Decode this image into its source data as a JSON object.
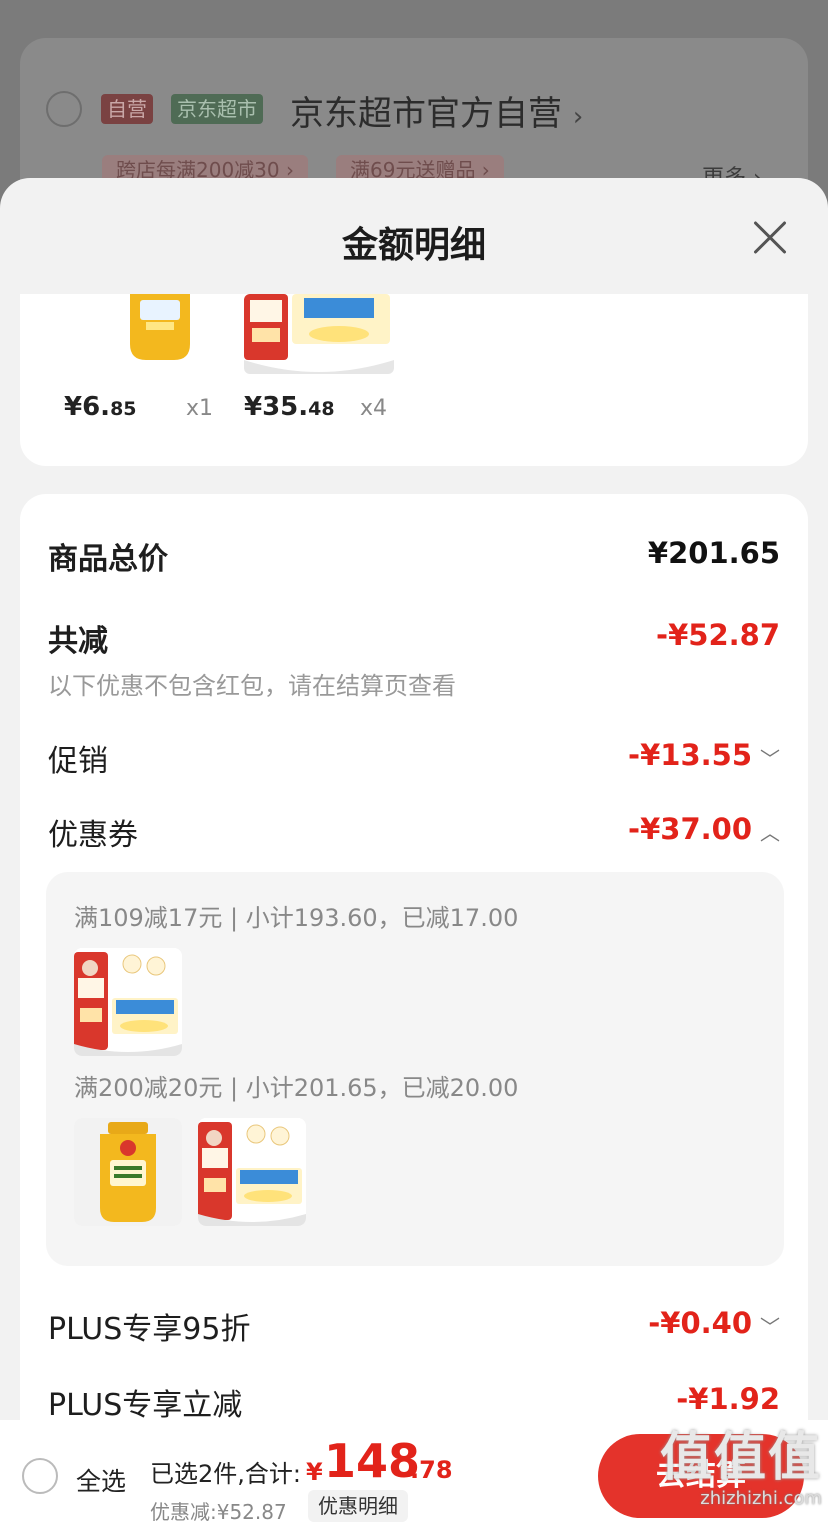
{
  "background": {
    "shop_tag_self": "自营",
    "shop_tag_jd": "京东超市",
    "shop_name": "京东超市官方自营",
    "promo_1": "跨店每满200减30",
    "promo_2": "满69元送赠品",
    "more": "更多"
  },
  "sheet": {
    "title": "金额明细"
  },
  "items": [
    {
      "price_int": "¥6.",
      "price_dec": "85",
      "qty": "x1"
    },
    {
      "price_int": "¥35.",
      "price_dec": "48",
      "qty": "x4"
    }
  ],
  "summary": {
    "total_label": "商品总价",
    "total_value": "¥201.65",
    "reduce_label": "共减",
    "reduce_value": "-¥52.87",
    "reduce_note": "以下优惠不包含红包，请在结算页查看",
    "promo_label": "促销",
    "promo_value": "-¥13.55",
    "coupon_label": "优惠券",
    "coupon_value": "-¥37.00",
    "coupons": [
      {
        "text": "满109减17元 | 小计193.60，已减17.00"
      },
      {
        "text": "满200减20元 | 小计201.65，已减20.00"
      }
    ],
    "plus95_label": "PLUS专享95折",
    "plus95_value": "-¥0.40",
    "plusreduce_label": "PLUS专享立减",
    "plusreduce_value": "-¥1.92"
  },
  "bottom": {
    "select_all": "全选",
    "selected": "已选2件,合计:",
    "yen": "¥",
    "total_int": "148",
    "total_dec": ".78",
    "discount": "优惠减:¥52.87",
    "detail_button": "优惠明细",
    "checkout": "去结算"
  },
  "watermark": {
    "big": "值值值",
    "small": "zhizhizhi.com"
  },
  "colors": {
    "accent_red": "#e2231a",
    "checkout_red": "#e4332b"
  }
}
